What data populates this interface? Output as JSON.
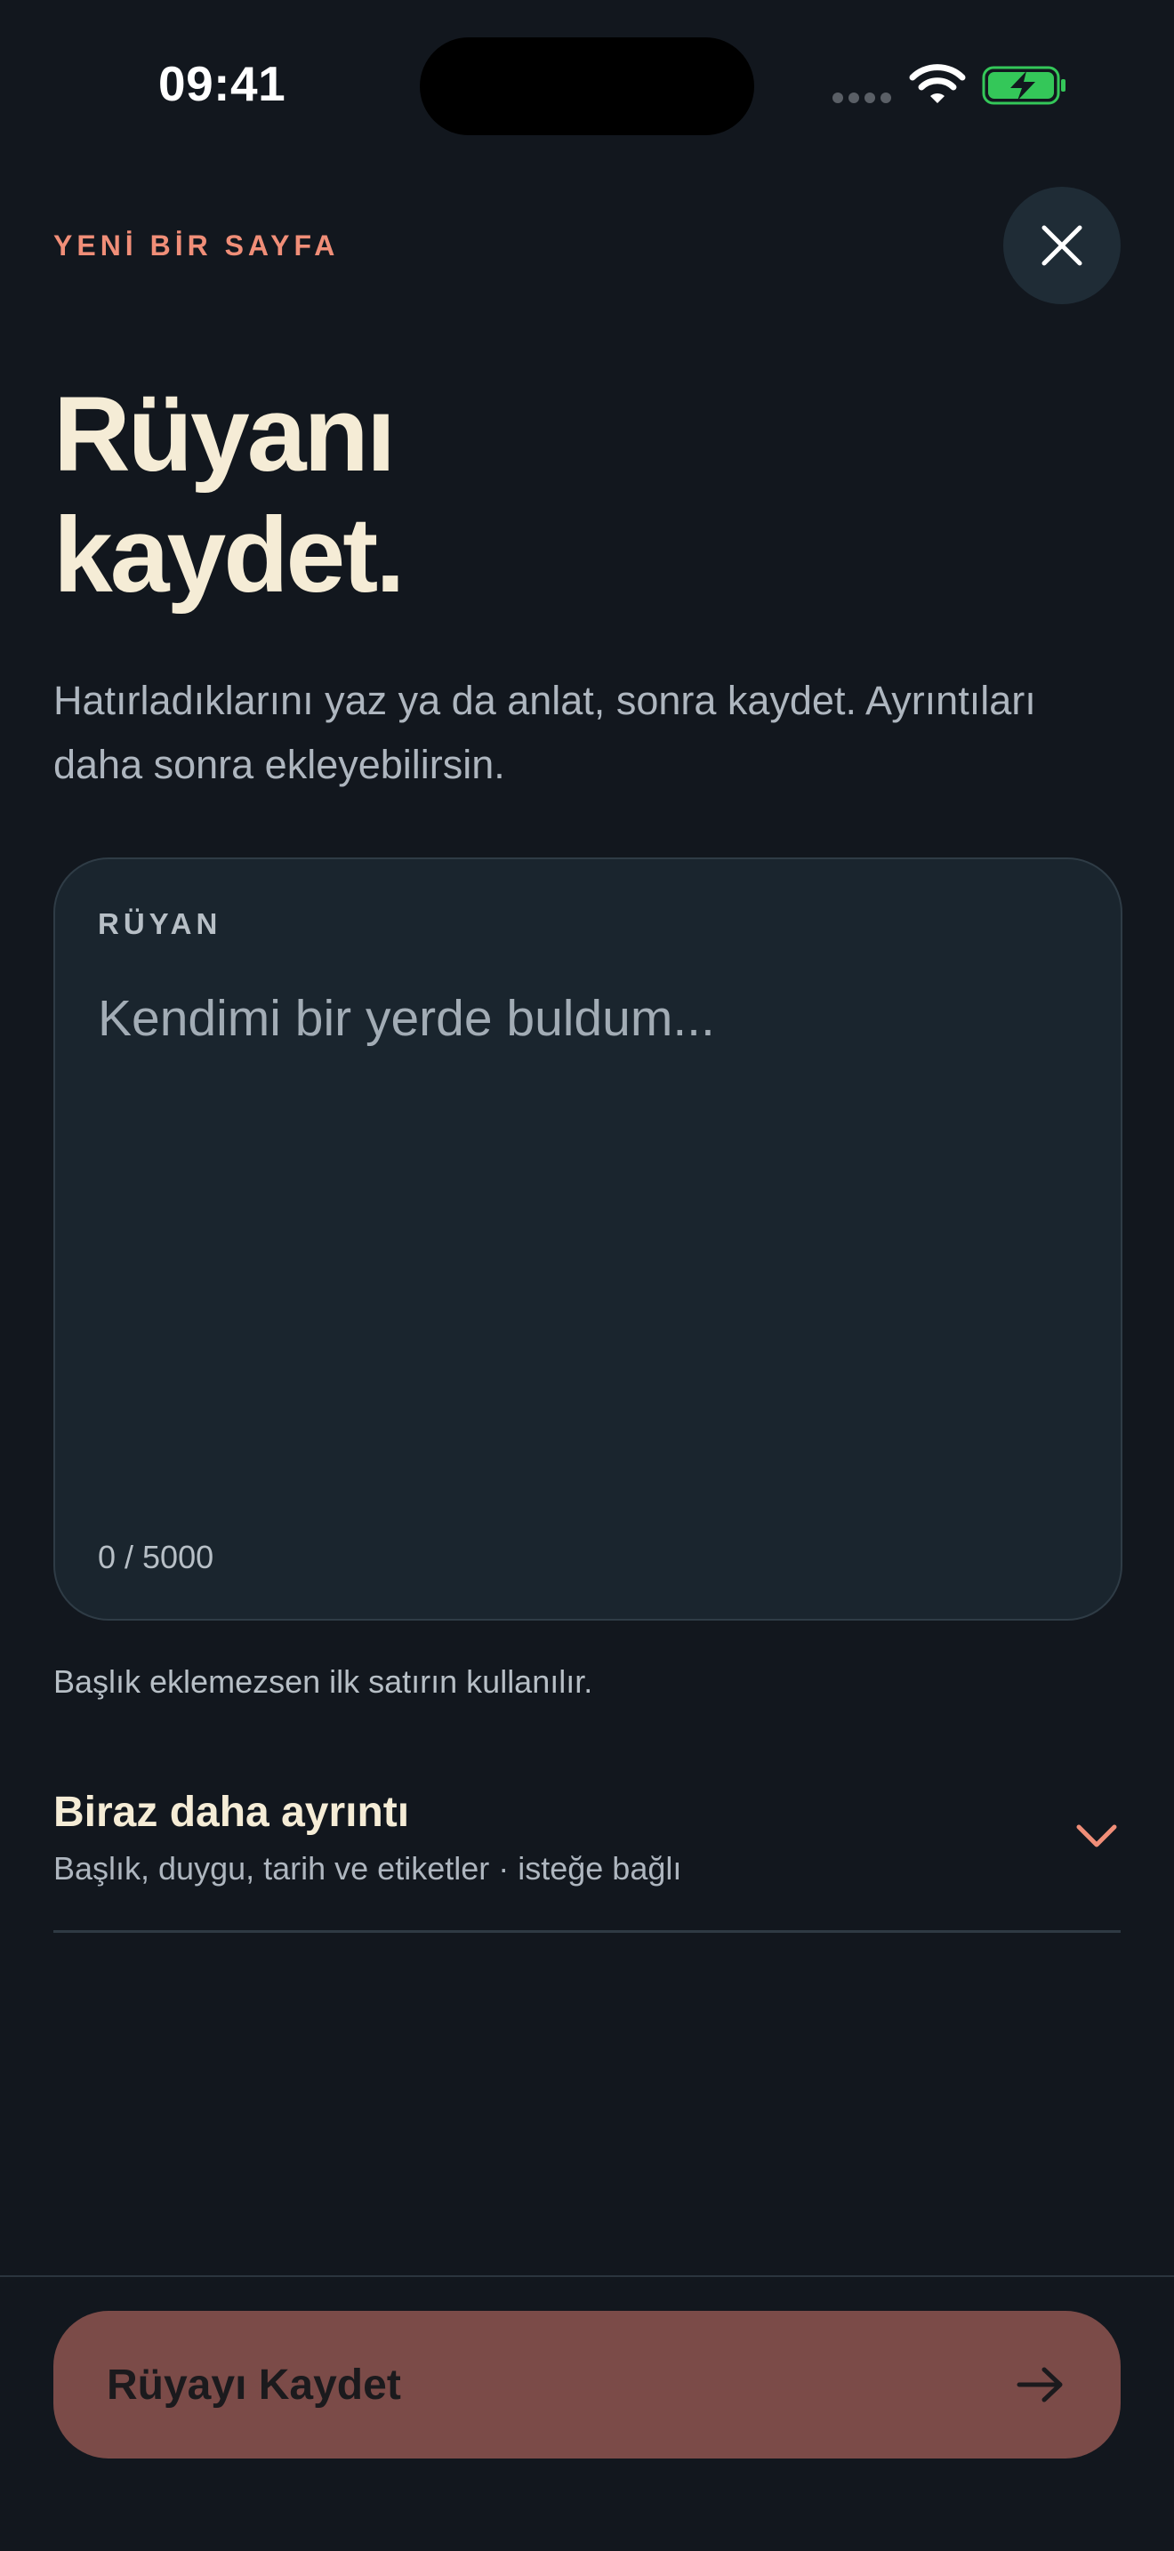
{
  "status_bar": {
    "time": "09:41",
    "icons": [
      "signal-icon",
      "wifi-icon",
      "battery-charging-icon"
    ],
    "battery_color": "#34c759"
  },
  "header": {
    "eyebrow": "YENİ BİR SAYFA",
    "close_icon": "close-icon",
    "title_line1": "Rüyanı",
    "title_line2": "kaydet.",
    "subtitle": "Hatırladıklarını yaz ya da anlat, sonra kaydet. Ayrıntıları daha sonra ekleyebilirsin."
  },
  "dream_card": {
    "label": "RÜYAN",
    "value": "",
    "placeholder": "Kendimi bir yerde buldum...",
    "counter": "0 / 5000"
  },
  "hint": "Başlık eklemezsen ilk satırın kullanılır.",
  "details": {
    "title": "Biraz daha ayrıntı",
    "subtitle": "Başlık, duygu, tarih ve etiketler · isteğe bağlı",
    "icon": "chevron-down-icon"
  },
  "footer": {
    "save_label": "Rüyayı Kaydet",
    "icon": "arrow-right-icon"
  },
  "colors": {
    "background": "#12171e",
    "accent": "#f08e78",
    "card": "#1a252e",
    "button": "#7b4b48"
  }
}
